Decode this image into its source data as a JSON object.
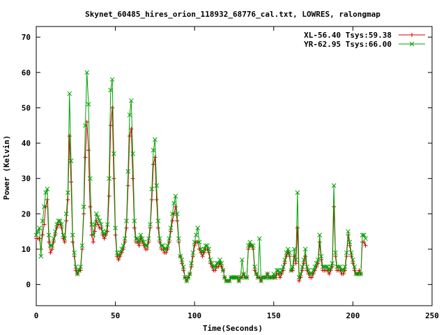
{
  "chart_data": {
    "type": "line",
    "title": "Skynet_60485_hires_orion_118932_68776_cal.txt, LOWRES, ralongmap",
    "xlabel": "Time(Seconds)",
    "ylabel": "Power (Kelvin)",
    "xlim": [
      0,
      250
    ],
    "ylim": [
      -6,
      73
    ],
    "x_ticks": [
      0,
      50,
      100,
      150,
      200,
      250
    ],
    "y_ticks": [
      0,
      10,
      20,
      30,
      40,
      50,
      60,
      70
    ],
    "grid": false,
    "legend_position": "top-right",
    "series": [
      {
        "name": "XL-56.40 Tsys:59.38",
        "color": "#cc0000",
        "marker": "plus",
        "x": [
          0,
          1,
          2,
          3,
          4,
          5,
          6,
          7,
          8,
          9,
          10,
          11,
          12,
          13,
          14,
          15,
          16,
          17,
          18,
          19,
          20,
          21,
          22,
          23,
          24,
          25,
          26,
          27,
          28,
          29,
          30,
          31,
          32,
          33,
          34,
          35,
          36,
          37,
          38,
          39,
          40,
          41,
          42,
          43,
          44,
          45,
          46,
          47,
          48,
          49,
          50,
          51,
          52,
          53,
          54,
          55,
          56,
          57,
          58,
          59,
          60,
          61,
          62,
          63,
          64,
          65,
          66,
          67,
          68,
          69,
          70,
          71,
          72,
          73,
          74,
          75,
          76,
          77,
          78,
          79,
          80,
          81,
          82,
          83,
          84,
          85,
          86,
          87,
          88,
          89,
          90,
          91,
          92,
          93,
          94,
          95,
          96,
          97,
          98,
          99,
          100,
          101,
          102,
          103,
          104,
          105,
          106,
          107,
          108,
          109,
          110,
          111,
          112,
          113,
          114,
          115,
          116,
          117,
          118,
          119,
          120,
          121,
          122,
          123,
          124,
          125,
          126,
          127,
          128,
          129,
          130,
          131,
          132,
          133,
          134,
          135,
          136,
          137,
          138,
          139,
          140,
          141,
          142,
          143,
          144,
          145,
          146,
          147,
          148,
          149,
          150,
          151,
          152,
          153,
          154,
          155,
          156,
          157,
          158,
          159,
          160,
          161,
          162,
          163,
          164,
          165,
          166,
          167,
          168,
          169,
          170,
          171,
          172,
          173,
          174,
          175,
          176,
          177,
          178,
          179,
          180,
          181,
          182,
          183,
          184,
          185,
          186,
          187,
          188,
          189,
          190,
          191,
          192,
          193,
          194,
          195,
          196,
          197,
          198,
          199,
          200,
          201,
          202,
          203,
          204,
          205,
          206,
          207,
          208
        ],
        "y": [
          13,
          13,
          13,
          10,
          14,
          17,
          22,
          24,
          12,
          9,
          10,
          12,
          14,
          16,
          17,
          17,
          16,
          13,
          12,
          18,
          24,
          42,
          29,
          12,
          8,
          4,
          3,
          4,
          4,
          10,
          20,
          36,
          46,
          38,
          22,
          14,
          12,
          15,
          18,
          17,
          16,
          16,
          14,
          13,
          14,
          15,
          25,
          45,
          50,
          30,
          14,
          8,
          7,
          8,
          9,
          10,
          12,
          16,
          28,
          42,
          44,
          30,
          16,
          12,
          12,
          11,
          13,
          12,
          11,
          10,
          10,
          12,
          16,
          24,
          34,
          36,
          24,
          16,
          12,
          10,
          10,
          9,
          9,
          10,
          12,
          15,
          18,
          20,
          22,
          18,
          12,
          8,
          6,
          4,
          2,
          1,
          2,
          3,
          5,
          8,
          11,
          12,
          12,
          10,
          9,
          8,
          9,
          10,
          10,
          9,
          6,
          5,
          4,
          4,
          5,
          5,
          6,
          5,
          4,
          2,
          1,
          1,
          1,
          2,
          2,
          2,
          2,
          2,
          1,
          2,
          2,
          3,
          2,
          2,
          10,
          11,
          11,
          10,
          4,
          3,
          2,
          2,
          1,
          2,
          2,
          2,
          3,
          2,
          2,
          2,
          2,
          2,
          3,
          3,
          2,
          3,
          4,
          6,
          8,
          9,
          8,
          4,
          4,
          8,
          6,
          16,
          1,
          2,
          4,
          6,
          8,
          4,
          3,
          2,
          2,
          3,
          4,
          5,
          6,
          12,
          7,
          4,
          4,
          4,
          4,
          3,
          4,
          5,
          22,
          8,
          4,
          4,
          4,
          3,
          3,
          4,
          8,
          14,
          11,
          8,
          6,
          4,
          3,
          3,
          4,
          3,
          12,
          12,
          11
        ]
      },
      {
        "name": "YR-62.95 Tsys:66.00",
        "color": "#00a000",
        "marker": "cross",
        "x": [
          0,
          1,
          2,
          3,
          4,
          5,
          6,
          7,
          8,
          9,
          10,
          11,
          12,
          13,
          14,
          15,
          16,
          17,
          18,
          19,
          20,
          21,
          22,
          23,
          24,
          25,
          26,
          27,
          28,
          29,
          30,
          31,
          32,
          33,
          34,
          35,
          36,
          37,
          38,
          39,
          40,
          41,
          42,
          43,
          44,
          45,
          46,
          47,
          48,
          49,
          50,
          51,
          52,
          53,
          54,
          55,
          56,
          57,
          58,
          59,
          60,
          61,
          62,
          63,
          64,
          65,
          66,
          67,
          68,
          69,
          70,
          71,
          72,
          73,
          74,
          75,
          76,
          77,
          78,
          79,
          80,
          81,
          82,
          83,
          84,
          85,
          86,
          87,
          88,
          89,
          90,
          91,
          92,
          93,
          94,
          95,
          96,
          97,
          98,
          99,
          100,
          101,
          102,
          103,
          104,
          105,
          106,
          107,
          108,
          109,
          110,
          111,
          112,
          113,
          114,
          115,
          116,
          117,
          118,
          119,
          120,
          121,
          122,
          123,
          124,
          125,
          126,
          127,
          128,
          129,
          130,
          131,
          132,
          133,
          134,
          135,
          136,
          137,
          138,
          139,
          140,
          141,
          142,
          143,
          144,
          145,
          146,
          147,
          148,
          149,
          150,
          151,
          152,
          153,
          154,
          155,
          156,
          157,
          158,
          159,
          160,
          161,
          162,
          163,
          164,
          165,
          166,
          167,
          168,
          169,
          170,
          171,
          172,
          173,
          174,
          175,
          176,
          177,
          178,
          179,
          180,
          181,
          182,
          183,
          184,
          185,
          186,
          187,
          188,
          189,
          190,
          191,
          192,
          193,
          194,
          195,
          196,
          197,
          198,
          199,
          200,
          201,
          202,
          203,
          204,
          205,
          206,
          207,
          208
        ],
        "y": [
          14,
          15,
          16,
          8,
          18,
          22,
          26,
          27,
          14,
          11,
          11,
          13,
          15,
          17,
          18,
          18,
          17,
          14,
          13,
          20,
          26,
          54,
          35,
          14,
          9,
          5,
          3,
          4,
          5,
          11,
          22,
          45,
          60,
          51,
          30,
          17,
          14,
          17,
          20,
          19,
          18,
          17,
          15,
          14,
          15,
          17,
          30,
          55,
          58,
          37,
          16,
          9,
          8,
          9,
          10,
          11,
          13,
          18,
          32,
          48,
          52,
          37,
          18,
          13,
          13,
          12,
          14,
          13,
          12,
          11,
          11,
          13,
          17,
          27,
          38,
          41,
          28,
          18,
          13,
          11,
          11,
          10,
          10,
          11,
          13,
          16,
          20,
          23,
          25,
          20,
          13,
          8,
          7,
          5,
          2,
          1,
          2,
          3,
          6,
          9,
          12,
          14,
          16,
          12,
          10,
          9,
          10,
          11,
          11,
          10,
          7,
          6,
          5,
          5,
          6,
          6,
          7,
          6,
          4,
          2,
          1,
          1,
          1,
          2,
          2,
          2,
          2,
          2,
          1,
          2,
          7,
          3,
          2,
          2,
          11,
          12,
          11,
          11,
          5,
          3,
          2,
          13,
          1,
          2,
          2,
          2,
          3,
          2,
          2,
          2,
          3,
          2,
          4,
          4,
          3,
          4,
          5,
          7,
          9,
          10,
          9,
          4,
          5,
          10,
          7,
          26,
          2,
          3,
          5,
          7,
          10,
          5,
          4,
          3,
          3,
          4,
          5,
          6,
          7,
          14,
          8,
          5,
          5,
          5,
          5,
          4,
          5,
          6,
          28,
          9,
          5,
          5,
          5,
          4,
          4,
          5,
          9,
          15,
          12,
          9,
          7,
          5,
          3,
          3,
          3,
          3,
          14,
          14,
          13
        ]
      }
    ]
  }
}
